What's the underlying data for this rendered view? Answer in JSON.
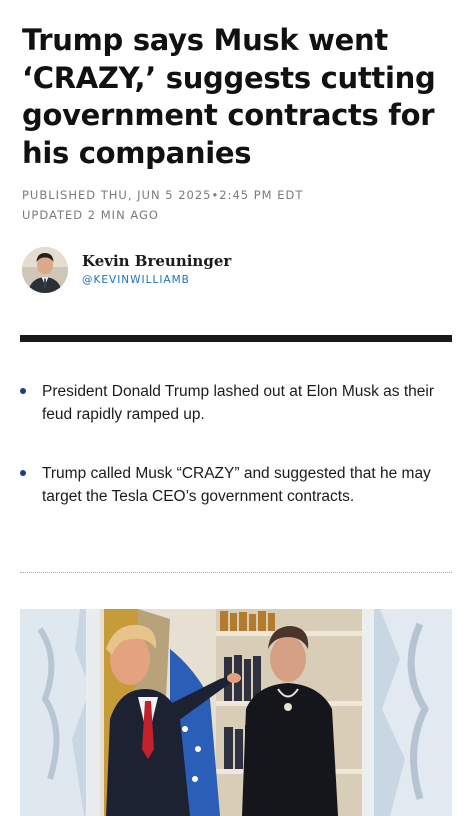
{
  "article": {
    "headline": "Trump says Musk went ‘CRAZY,’ suggests cutting government contracts for his companies",
    "published": "PUBLISHED THU, JUN 5 2025•2:45 PM EDT",
    "updated": "UPDATED 2 MIN AGO"
  },
  "author": {
    "name": "Kevin Breuninger",
    "handle": "@KEVINWILLIAMB"
  },
  "key_points": [
    "President Donald Trump lashed out at Elon Musk as their feud rapidly ramped up.",
    "Trump called Musk “CRAZY” and suggested that he may target the Tesla CEO’s government contracts."
  ],
  "colors": {
    "bullet": "#1a3e8c",
    "handle": "#1b73c4",
    "rule": "#1a1a1a"
  }
}
